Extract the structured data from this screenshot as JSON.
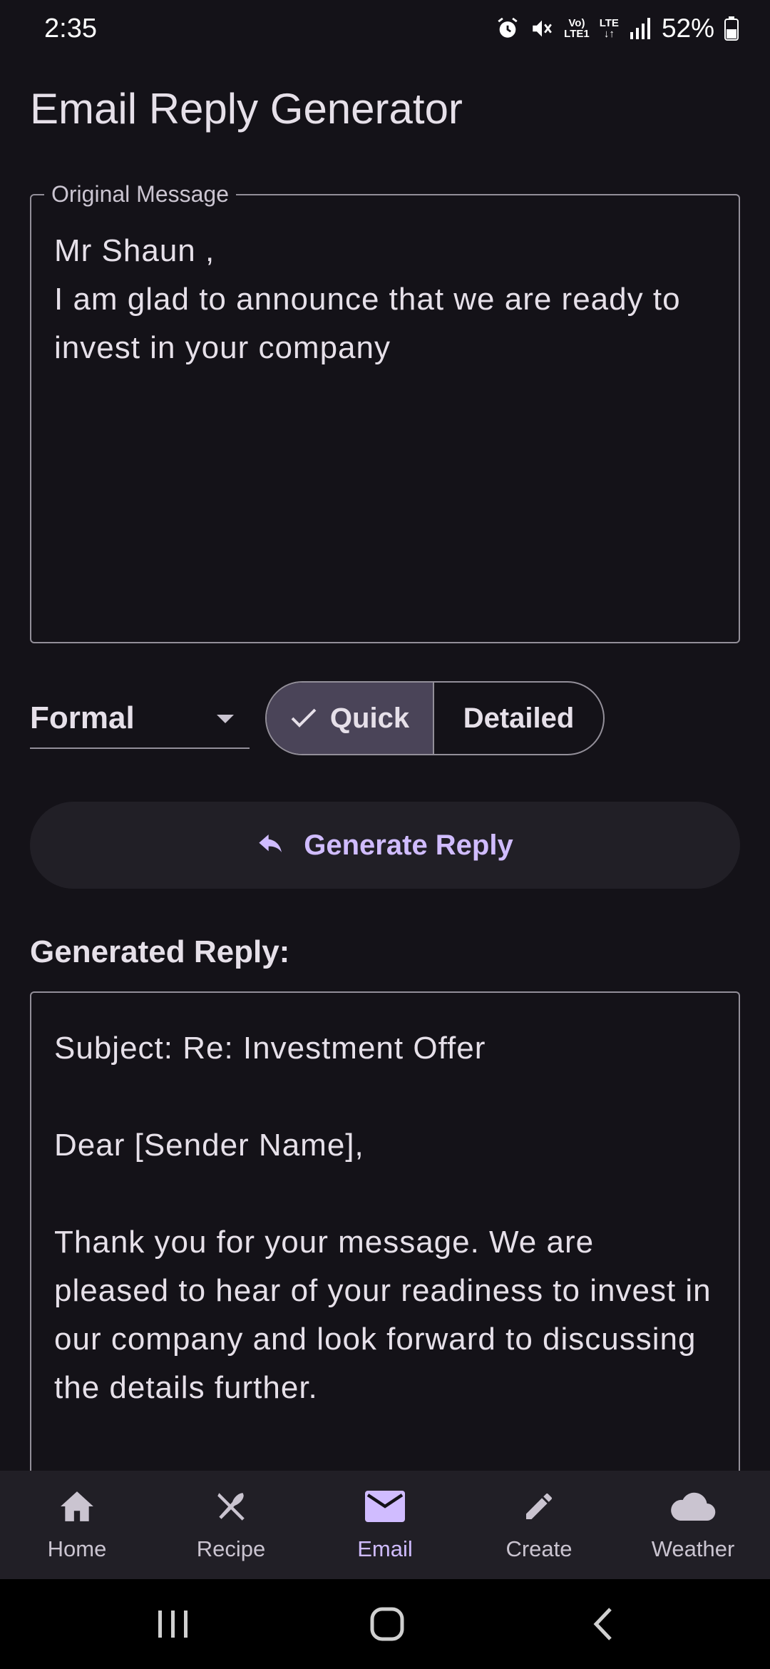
{
  "status_bar": {
    "time": "2:35",
    "battery": "52%",
    "network_top": "Vo)",
    "network_bottom": "LTE1",
    "network_type": "LTE"
  },
  "app": {
    "title": "Email Reply Generator"
  },
  "original_message": {
    "label": "Original Message",
    "value": "Mr Shaun ,\nI am glad to announce that we are ready to invest in your company"
  },
  "tone": {
    "selected": "Formal"
  },
  "length_toggle": {
    "options": [
      "Quick",
      "Detailed"
    ],
    "selected": "Quick"
  },
  "generate_button": {
    "label": "Generate Reply"
  },
  "generated_reply": {
    "heading": "Generated Reply:",
    "value": "Subject: Re: Investment Offer\n\nDear [Sender Name],\n\nThank you for your message. We are pleased to hear of your readiness to invest in our company and look forward to discussing the details further."
  },
  "bottom_nav": {
    "items": [
      {
        "label": "Home",
        "icon": "home-icon"
      },
      {
        "label": "Recipe",
        "icon": "utensils-icon"
      },
      {
        "label": "Email",
        "icon": "mail-icon"
      },
      {
        "label": "Create",
        "icon": "pencil-icon"
      },
      {
        "label": "Weather",
        "icon": "cloud-icon"
      }
    ],
    "active": "Email"
  },
  "colors": {
    "background": "#141218",
    "accent": "#d0bcff",
    "selected_segment": "#4a4458",
    "outline": "#938f99"
  }
}
